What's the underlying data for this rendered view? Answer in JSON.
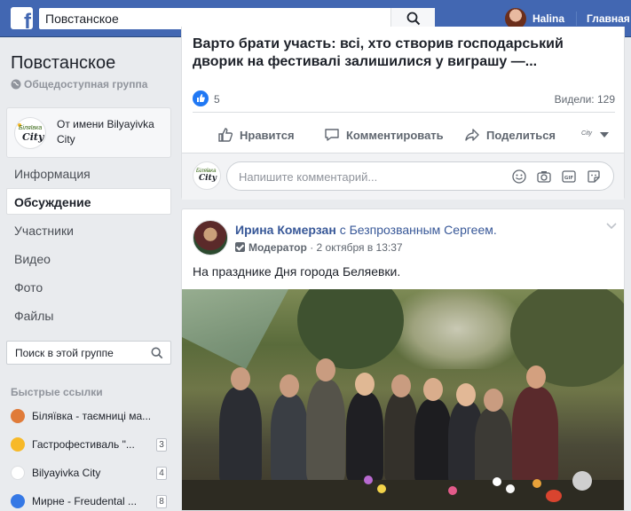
{
  "topbar": {
    "search_query": "Повстанское",
    "user_name": "Halina",
    "home_label": "Главная"
  },
  "group": {
    "title": "Повстанское",
    "type": "Общедоступная группа"
  },
  "acting_as": {
    "text": "От имени Bilyayivka City",
    "logo_top": "Біляївка",
    "logo_bottom": "City"
  },
  "nav": {
    "items": [
      "Информация",
      "Обсуждение",
      "Участники",
      "Видео",
      "Фото",
      "Файлы"
    ],
    "active": "Обсуждение"
  },
  "group_search": {
    "placeholder": "Поиск в этой группе"
  },
  "shortcuts": {
    "title": "Быстрые ссылки",
    "items": [
      {
        "label": "Біляївка - таємниці ма...",
        "count": "",
        "color": "#e07b39"
      },
      {
        "label": "Гастрофестиваль \"...",
        "count": "3",
        "color": "#f7b928"
      },
      {
        "label": "Bilyayivka City",
        "count": "4",
        "color": "#ffffff"
      },
      {
        "label": "Мирне - Freudental ...",
        "count": "8",
        "color": "#3578e5"
      }
    ]
  },
  "post1": {
    "title": "Варто брати участь: всі, хто створив господарський дворик на фестивалі залишилися у виграшу —...",
    "likes": "5",
    "views": "Видели: 129",
    "actions": {
      "like": "Нравится",
      "comment": "Комментировать",
      "share": "Поделиться"
    },
    "comment_placeholder": "Напишите комментарий..."
  },
  "post2": {
    "author": "Ирина Комерзан",
    "with_text": "с Безпрозванным Сергеем.",
    "role": "Модератор",
    "time": "· 2 октября в 13:37",
    "text": "На празднике Дня города Беляевки."
  },
  "colors": {
    "brand": "#4267b2",
    "link": "#385898",
    "like": "#2078f4"
  }
}
